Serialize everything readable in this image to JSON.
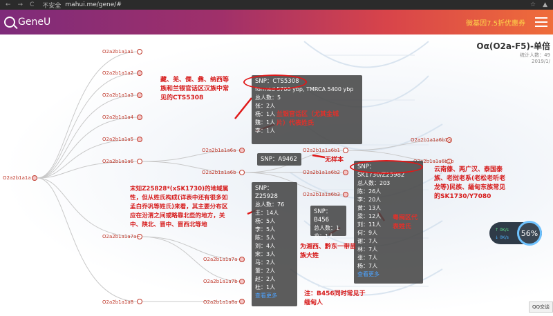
{
  "browser": {
    "back": "←",
    "forward": "→",
    "reload": "C",
    "insecure_label": "不安全",
    "url": "mahui.me/gene/#",
    "star": "☆",
    "account": "▲"
  },
  "header": {
    "logo_text": "GeneU",
    "promo": "微基因7.5折优惠券"
  },
  "page": {
    "title": "Oα(O2a-F5)-单倍",
    "stats_line1": "统计人数：49",
    "stats_line2": "2019/1/"
  },
  "tree": {
    "root": "O2a2b1a1a",
    "level1": [
      "O2a2b1a1a1",
      "O2a2b1a1a2",
      "O2a2b1a1a3",
      "O2a2b1a1a4",
      "O2a2b1a1a5",
      "O2a2b1a1a6",
      "O2a2b1a1a7a~",
      "O2a2b1a1a8"
    ],
    "a6_children": [
      "O2a2b1a1a6a",
      "O2a2b1a1a6b"
    ],
    "a6b_children": [
      "O2a2b1a1a6b1",
      "O2a2b1a1a6b2",
      "O2a2b1a1a6b3"
    ],
    "a6b1_children": [
      "O2a2b1a1a6b1a",
      "O2a2b1a1a6b1b"
    ],
    "a7_children": [
      "O2a2b1a1a7a",
      "O2a2b1a1a7b"
    ],
    "a8_child": "O2a2b1a1a8a"
  },
  "popups": {
    "cts5308": {
      "snp": "SNP：CTS5308",
      "formed": "formed 5700 ybp, TMRCA 5400 ybp",
      "total": "总人数：5",
      "rows": [
        "张：2人",
        "杨：1人",
        "魏：1人",
        "李：1人"
      ]
    },
    "a9462": {
      "snp": "SNP：A9462"
    },
    "z25928": {
      "snp": "SNP：Z25928",
      "total": "总人数：76",
      "rows": [
        "王：14人",
        "杨：5人",
        "李：5人",
        "陈：5人",
        "刘：4人",
        "宋：3人",
        "马：2人",
        "董：2人",
        "赵：2人",
        "杜：1人"
      ],
      "more": "查看更多"
    },
    "b456": {
      "snp": "SNP：B456",
      "total": "总人数：1",
      "rows": [
        "龙：1人"
      ]
    },
    "sk1730": {
      "snp": "SNP：SK1730/Z25982",
      "total": "总人数：203",
      "rows": [
        "陈：26人",
        "李：20人",
        "黄：13人",
        "梁：12人",
        "刘：11人",
        "何：9人",
        "谢：7人",
        "林：7人",
        "张：7人",
        "杨：7人"
      ],
      "more": "查看更多"
    }
  },
  "annotations": {
    "note_cts": "藏、羌、傈、彝、纳西等\n族和兰银官话区汉族中常\n见的CTS5308",
    "note_lanyin": "兰银官话区（尤其金城\n片）代表姓氏",
    "note_wuyangben": "无样本",
    "note_z25928": "末知Z25828*(xSK1730)的地域属\n性，但从姓氏构成(详表中还有很多如\n孟白乔巩等姓氏)来看，其主要分布区\n应在汾渭之间或略靠北些的地方，关\n中、陕北、晋中、晋西北等地",
    "note_sk1730": "云南傣、两广汉、泰国泰\n族、老挝老系(老松老听老\n龙等)民族、緬甸东族常见\n的SK1730/Y7080",
    "note_yuejiang": "粤闽区代\n表姓氏",
    "note_xiangxi": "为湘西、黔东一带苗\n族大姓",
    "note_b456": "注：B456同时常见于\n缅甸人"
  },
  "speed_widget": {
    "up": "0K/s",
    "down": "0K/s",
    "percent": "56%"
  },
  "qq_button": "QQ交谈"
}
